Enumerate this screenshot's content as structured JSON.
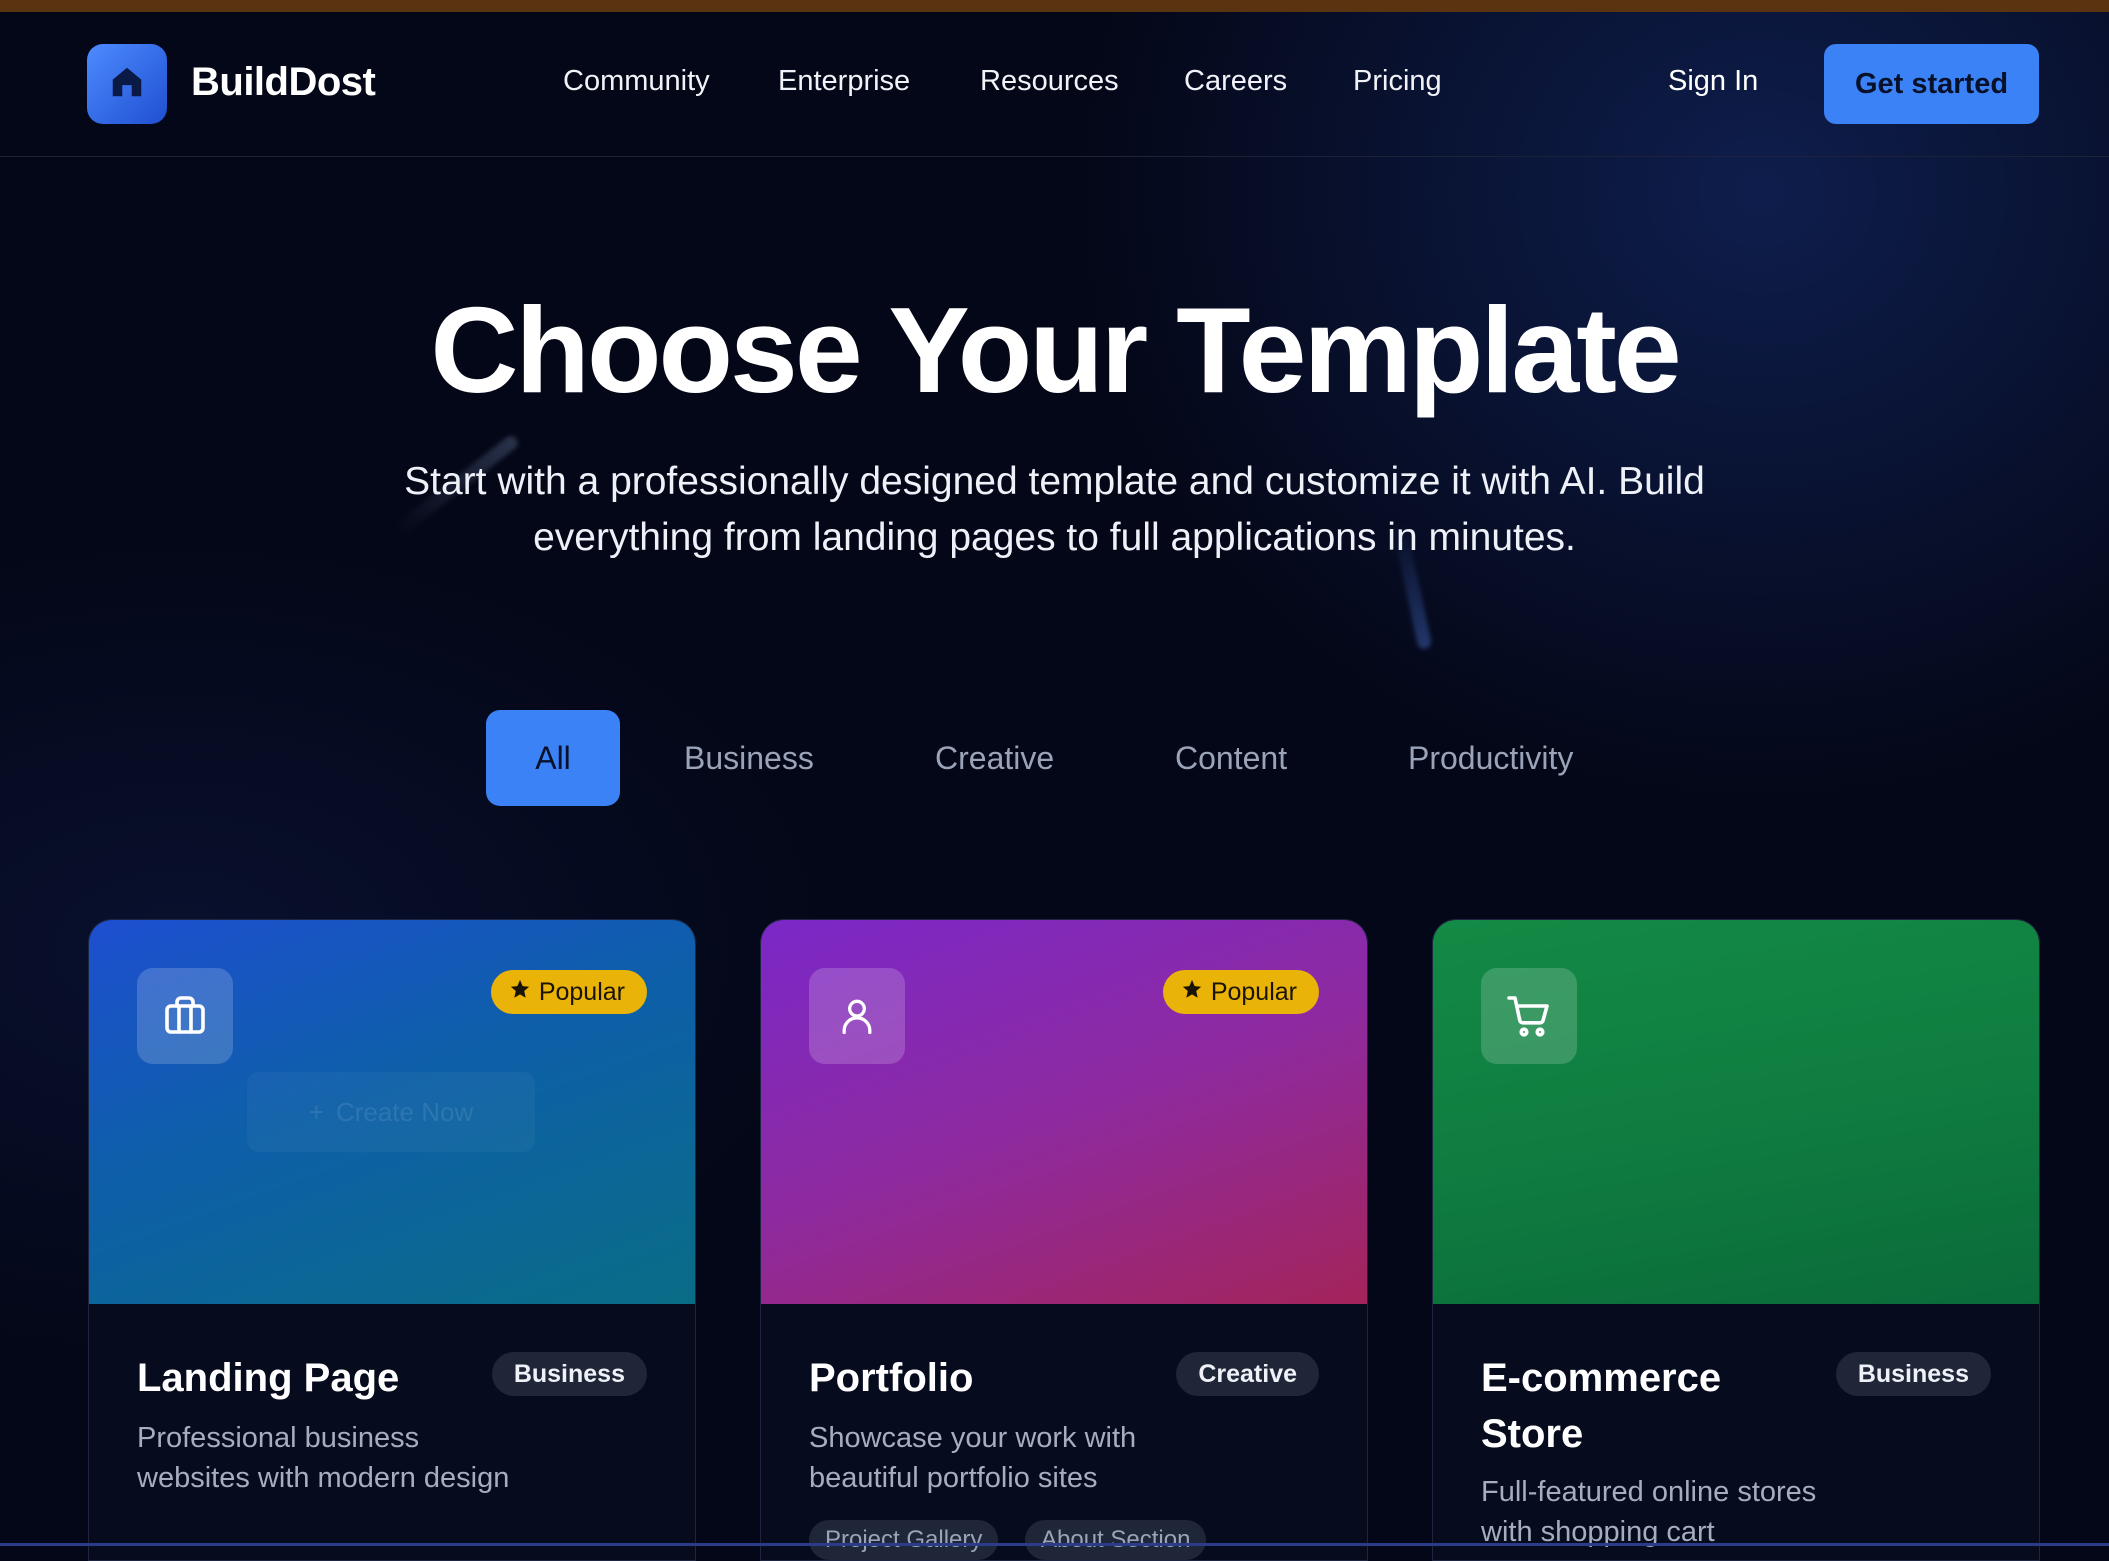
{
  "brand": {
    "name": "BuildDost",
    "logo_icon": "home-icon"
  },
  "nav": {
    "items": [
      "Community",
      "Enterprise",
      "Resources",
      "Careers",
      "Pricing"
    ]
  },
  "auth": {
    "signin": "Sign In",
    "cta": "Get started"
  },
  "hero": {
    "title": "Choose Your Template",
    "subtitle_line1": "Start with a professionally designed template and customize it with AI. Build",
    "subtitle_line2": "everything from landing pages to full applications in minutes."
  },
  "filters": {
    "items": [
      "All",
      "Business",
      "Creative",
      "Content",
      "Productivity"
    ],
    "active": "All"
  },
  "cards": [
    {
      "title": "Landing Page",
      "description": "Professional business websites with modern design",
      "category": "Business",
      "badge": "Popular",
      "icon": "briefcase-icon",
      "hover_action": "Create Now",
      "tags": []
    },
    {
      "title": "Portfolio",
      "description": "Showcase your work with beautiful portfolio sites",
      "category": "Creative",
      "badge": "Popular",
      "icon": "user-icon",
      "tags": [
        "Project Gallery",
        "About Section"
      ]
    },
    {
      "title": "E-commerce Store",
      "description": "Full-featured online stores with shopping cart",
      "category": "Business",
      "badge": "",
      "icon": "shopping-cart-icon",
      "tags": []
    }
  ],
  "colors": {
    "background": "#040717",
    "accent": "#3b82f6",
    "popular_badge": "#eab308",
    "card1_gradient": [
      "#1d4fd0",
      "#0a6d86"
    ],
    "card2_gradient": [
      "#7b28c8",
      "#a3245a"
    ],
    "card3_gradient": [
      "#138a45",
      "#0a6b3a"
    ]
  }
}
